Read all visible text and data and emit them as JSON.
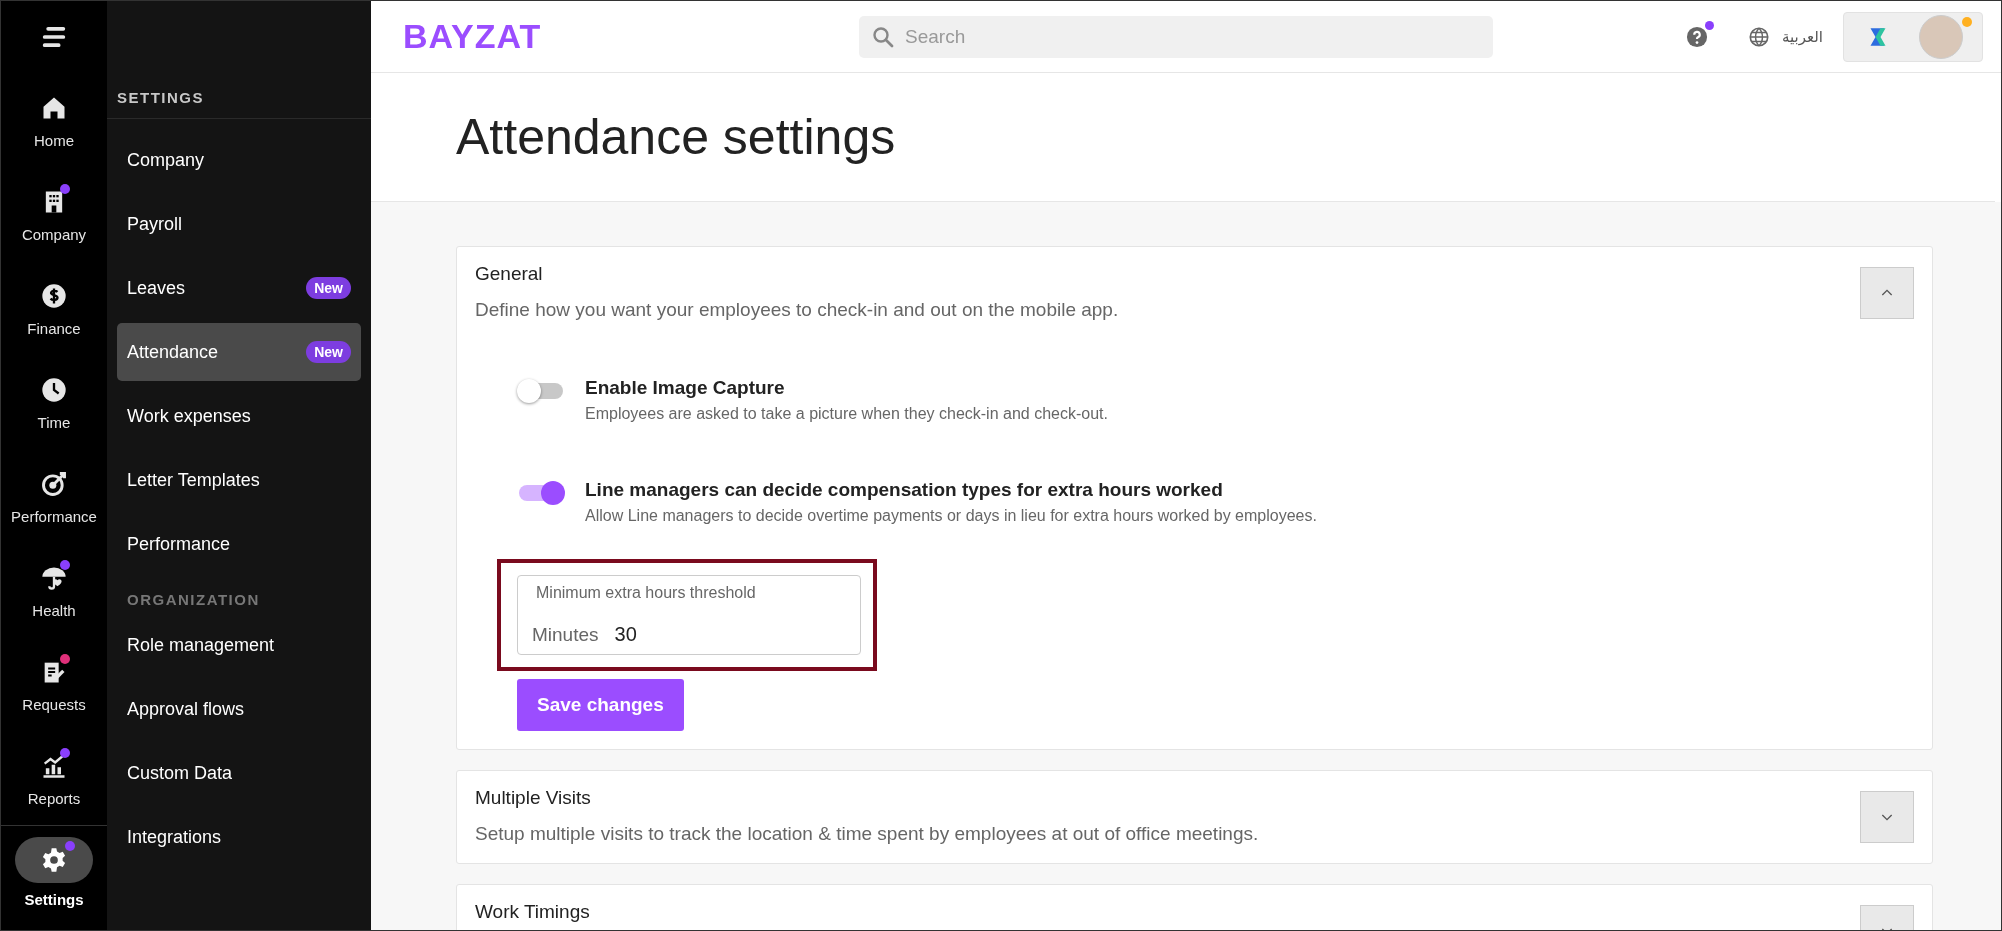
{
  "rail": {
    "items": [
      {
        "label": "Home",
        "selected": false
      },
      {
        "label": "Company",
        "selected": false,
        "color": "#8a3ffc"
      },
      {
        "label": "Finance",
        "selected": false
      },
      {
        "label": "Time",
        "selected": false
      },
      {
        "label": "Performance",
        "selected": false
      },
      {
        "label": "Health",
        "selected": false,
        "color": "#8a3ffc"
      },
      {
        "label": "Requests",
        "selected": false,
        "color": "#e0307a"
      },
      {
        "label": "Reports",
        "selected": false,
        "color": "#8a3ffc"
      },
      {
        "label": "Settings",
        "selected": true,
        "color": "#8a3ffc"
      }
    ]
  },
  "settings_menu": {
    "sections": [
      {
        "heading": "SETTINGS",
        "items": [
          {
            "label": "Company",
            "selected": false
          },
          {
            "label": "Payroll",
            "selected": false
          },
          {
            "label": "Leaves",
            "selected": false,
            "badge": "New"
          },
          {
            "label": "Attendance",
            "selected": true,
            "badge": "New"
          },
          {
            "label": "Work expenses",
            "selected": false
          },
          {
            "label": "Letter Templates",
            "selected": false
          },
          {
            "label": "Performance",
            "selected": false
          }
        ]
      },
      {
        "heading": "ORGANIZATION",
        "items": [
          {
            "label": "Role management",
            "selected": false
          },
          {
            "label": "Approval flows",
            "selected": false
          },
          {
            "label": "Custom Data",
            "selected": false
          },
          {
            "label": "Integrations",
            "selected": false
          }
        ]
      }
    ]
  },
  "topbar": {
    "logo": "BAYZAT",
    "search": {
      "placeholder": "Search"
    },
    "help_dot": true,
    "language": "العربية",
    "profile_status_dot": true
  },
  "page_title": "Attendance settings",
  "sections": [
    {
      "title": "General",
      "description": "Define how you want your employees to check-in and out on the mobile app.",
      "expanded": true,
      "settings": [
        {
          "label": "Enable Image Capture",
          "description": "Employees are asked to take a picture when they check-in and check-out.",
          "on": false
        },
        {
          "label": "Line managers can decide compensation types for extra hours worked",
          "description": "Allow Line managers to decide overtime payments or days in lieu for extra hours worked by employees.",
          "on": true
        }
      ],
      "field": {
        "label": "Minimum extra hours threshold",
        "unit": "Minutes",
        "value": "30",
        "highlighted": true
      },
      "button": "Save changes"
    },
    {
      "title": "Multiple Visits",
      "description": "Setup multiple visits to track the location & time spent by employees at out of office meetings.",
      "expanded": false
    },
    {
      "title": "Work Timings",
      "expanded": false
    }
  ]
}
